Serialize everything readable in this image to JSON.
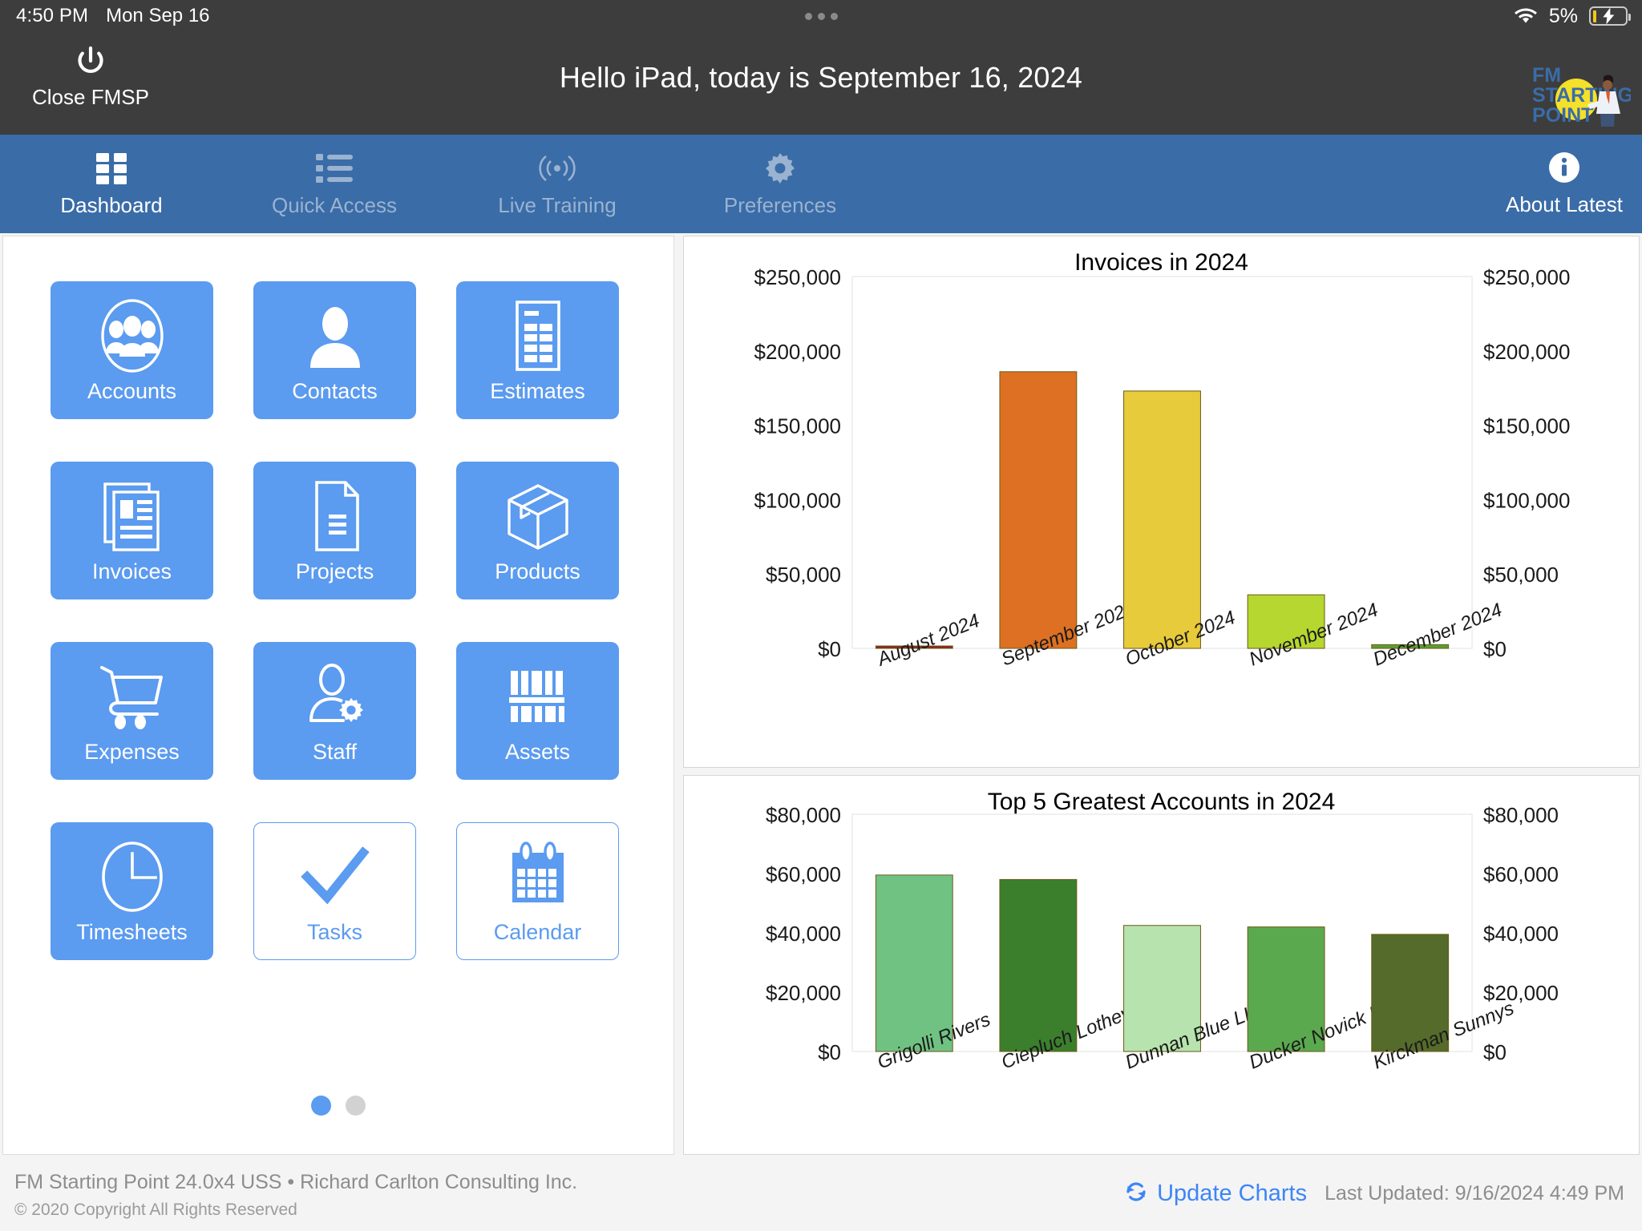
{
  "status_bar": {
    "time": "4:50 PM",
    "date": "Mon Sep 16",
    "battery_percent": "5%",
    "wifi_icon": "wifi-icon",
    "battery_icon": "battery-charging-icon",
    "dots_icon": "three-dots-icon"
  },
  "header": {
    "close_label": "Close FMSP",
    "power_icon": "power-icon",
    "title": "Hello iPad, today is September 16, 2024",
    "logo_line1": "FM",
    "logo_line2": "STARTING",
    "logo_line3": "POINT",
    "logo_name": "fm-starting-point-logo"
  },
  "nav": {
    "items": [
      {
        "label": "Dashboard",
        "icon": "grid-icon",
        "active": true
      },
      {
        "label": "Quick Access",
        "icon": "list-icon",
        "active": false
      },
      {
        "label": "Live Training",
        "icon": "broadcast-icon",
        "active": false
      },
      {
        "label": "Preferences",
        "icon": "gear-icon",
        "active": false
      }
    ],
    "about": {
      "label": "About Latest",
      "icon": "info-icon"
    }
  },
  "tiles": [
    {
      "label": "Accounts",
      "icon": "accounts-group-icon",
      "style": "filled"
    },
    {
      "label": "Contacts",
      "icon": "person-icon",
      "style": "filled"
    },
    {
      "label": "Estimates",
      "icon": "estimate-sheet-icon",
      "style": "filled"
    },
    {
      "label": "Invoices",
      "icon": "invoice-pages-icon",
      "style": "filled"
    },
    {
      "label": "Projects",
      "icon": "document-icon",
      "style": "filled"
    },
    {
      "label": "Products",
      "icon": "box-icon",
      "style": "filled"
    },
    {
      "label": "Expenses",
      "icon": "shopping-cart-icon",
      "style": "filled"
    },
    {
      "label": "Staff",
      "icon": "person-gear-icon",
      "style": "filled"
    },
    {
      "label": "Assets",
      "icon": "bookshelf-icon",
      "style": "filled"
    },
    {
      "label": "Timesheets",
      "icon": "clock-icon",
      "style": "filled"
    },
    {
      "label": "Tasks",
      "icon": "checkmark-icon",
      "style": "outline"
    },
    {
      "label": "Calendar",
      "icon": "calendar-icon",
      "style": "outline"
    }
  ],
  "pagination": {
    "pages": 2,
    "current": 1
  },
  "footer": {
    "line1": "FM Starting Point 24.0x4 USS • Richard Carlton Consulting Inc.",
    "line2": "© 2020 Copyright All Rights Reserved",
    "update_charts_label": "Update Charts",
    "refresh_icon": "refresh-icon",
    "last_updated": "Last Updated: 9/16/2024 4:49 PM"
  },
  "colors": {
    "nav_bar": "#3a6ca8",
    "header": "#3d3d3d",
    "tile_blue": "#5b9bf0",
    "link_blue": "#3d85f7",
    "logo_yellow": "#f5e02a",
    "logo_blue": "#3a6ca8"
  },
  "chart_data": [
    {
      "type": "bar",
      "title": "Invoices in 2024",
      "xlabel": "",
      "ylabel": "",
      "ylim": [
        0,
        250000
      ],
      "yticks": [
        0,
        50000,
        100000,
        150000,
        200000,
        250000
      ],
      "ytick_labels": [
        "$0",
        "$50,000",
        "$100,000",
        "$150,000",
        "$200,000",
        "$250,000"
      ],
      "dual_axis": true,
      "grid": false,
      "legend": "none",
      "categories": [
        "August 2024",
        "September 2024",
        "October 2024",
        "November 2024",
        "December 2024"
      ],
      "values": [
        500,
        186000,
        173000,
        36000,
        2500
      ],
      "bar_colors": [
        "#8f2020",
        "#dd7022",
        "#e8cb3a",
        "#b5d72f",
        "#5aa032"
      ]
    },
    {
      "type": "bar",
      "title": "Top 5 Greatest Accounts in 2024",
      "xlabel": "",
      "ylabel": "",
      "ylim": [
        0,
        80000
      ],
      "yticks": [
        0,
        20000,
        40000,
        60000,
        80000
      ],
      "ytick_labels": [
        "$0",
        "$20,000",
        "$40,000",
        "$60,000",
        "$80,000"
      ],
      "dual_axis": true,
      "grid": false,
      "legend": "none",
      "categories": [
        "Grigolli Rivers",
        "Ciepluch Lothev",
        "Dunnan Blue LLC",
        "Ducker Novick L",
        "Kirckman Sunnys"
      ],
      "values": [
        59500,
        58000,
        42500,
        42000,
        39500
      ],
      "bar_colors": [
        "#70c283",
        "#3b7f2c",
        "#b7e3ae",
        "#5ba94f",
        "#556b2b"
      ]
    }
  ]
}
